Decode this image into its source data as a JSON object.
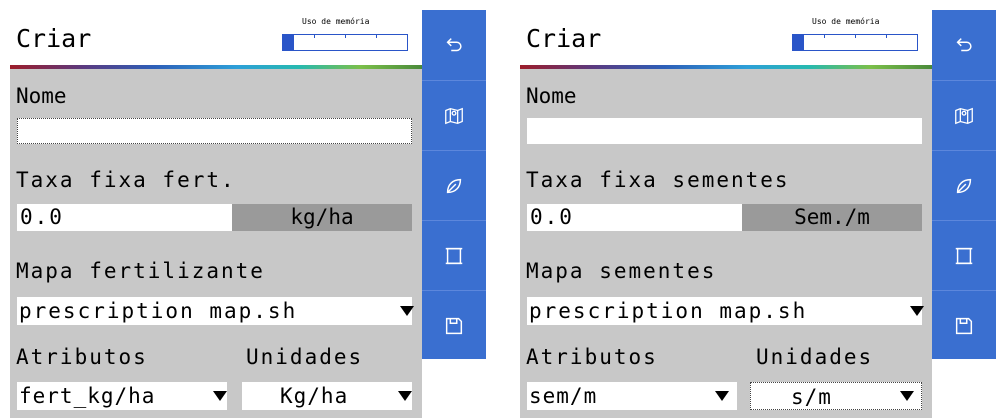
{
  "left": {
    "title": "Criar",
    "memory_label": "Uso de memória",
    "memory_fraction": 0.09,
    "name_label": "Nome",
    "name_value": "",
    "rate_label": "Taxa fixa fert.",
    "rate_value": "0.0",
    "rate_unit": "kg/ha",
    "map_label": "Mapa fertilizante",
    "map_value": "prescription map.sh",
    "attr_label": "Atributos",
    "units_label": "Unidades",
    "attr_value": "fert_kg/ha",
    "units_value": "Kg/ha"
  },
  "right": {
    "title": "Criar",
    "memory_label": "Uso de memória",
    "memory_fraction": 0.09,
    "name_label": "Nome",
    "name_value": "",
    "rate_label": "Taxa fixa sementes",
    "rate_value": "0.0",
    "rate_unit": "Sem./m",
    "map_label": "Mapa sementes",
    "map_value": "prescription map.sh",
    "attr_label": "Atributos",
    "units_label": "Unidades",
    "attr_value": "sem/m",
    "units_value": "s/m"
  },
  "sidebar": {
    "icons": [
      "back-icon",
      "map-icon",
      "leaf-icon",
      "boundary-icon",
      "save-icon"
    ]
  },
  "colors": {
    "accent": "#3a6fd0",
    "panel_bg": "#c8c8c8",
    "unit_bg": "#9a9a9a"
  }
}
